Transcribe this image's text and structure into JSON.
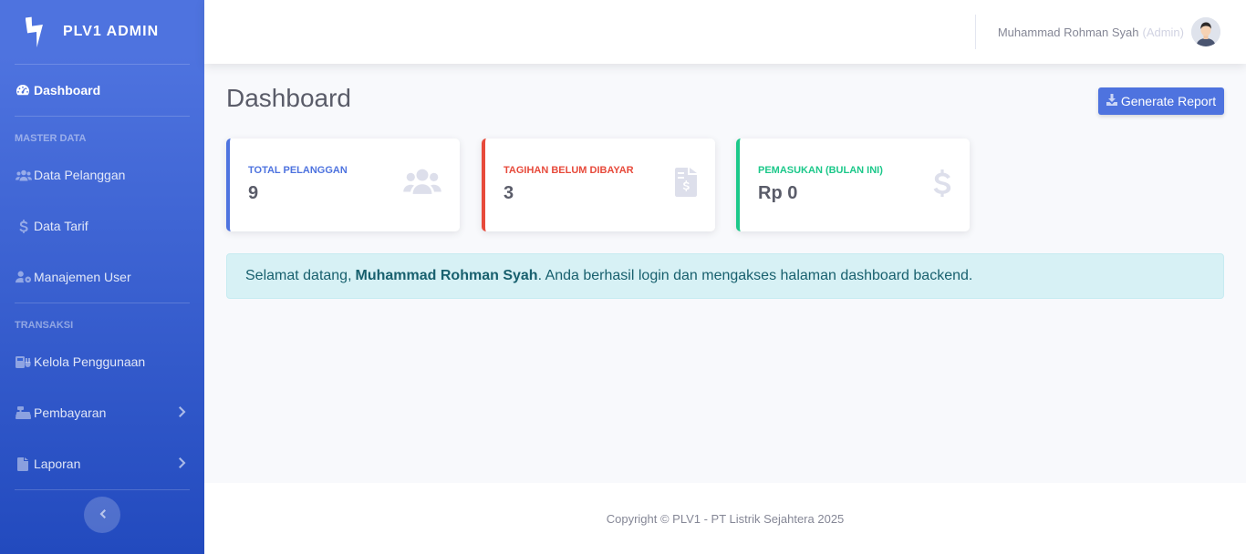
{
  "brand": {
    "name": "PLV1 ADMIN",
    "icon": "bolt-icon"
  },
  "sidebar": {
    "dashboard": {
      "label": "Dashboard",
      "icon": "tachometer-icon"
    },
    "headings": {
      "master": "MASTER DATA",
      "transaksi": "TRANSAKSI"
    },
    "items": [
      {
        "label": "Data Pelanggan",
        "icon": "users-icon"
      },
      {
        "label": "Data Tarif",
        "icon": "dollar-icon"
      },
      {
        "label": "Manajemen User",
        "icon": "user-cog-icon"
      },
      {
        "label": "Kelola Penggunaan",
        "icon": "plug-icon"
      },
      {
        "label": "Pembayaran",
        "icon": "cash-register-icon"
      },
      {
        "label": "Laporan",
        "icon": "file-icon"
      }
    ]
  },
  "topbar": {
    "user_name": "Muhammad Rohman Syah",
    "user_role": "(Admin)"
  },
  "page": {
    "title": "Dashboard",
    "report_button": "Generate Report"
  },
  "cards": [
    {
      "label": "TOTAL PELANGGAN",
      "value": "9",
      "color": "#4e73df",
      "icon": "users-icon"
    },
    {
      "label": "TAGIHAN BELUM DIBAYAR",
      "value": "3",
      "color": "#e74a3b",
      "icon": "file-invoice-dollar-icon"
    },
    {
      "label": "PEMASUKAN (BULAN INI)",
      "value": "Rp 0",
      "color": "#1cc88a",
      "icon": "dollar-sign-icon"
    }
  ],
  "alert": {
    "prefix": "Selamat datang,",
    "name": "Muhammad Rohman Syah",
    "suffix": ". Anda berhasil login dan mengakses halaman dashboard backend."
  },
  "footer": {
    "text": "Copyright © PLV1 - PT Listrik Sejahtera 2025"
  }
}
